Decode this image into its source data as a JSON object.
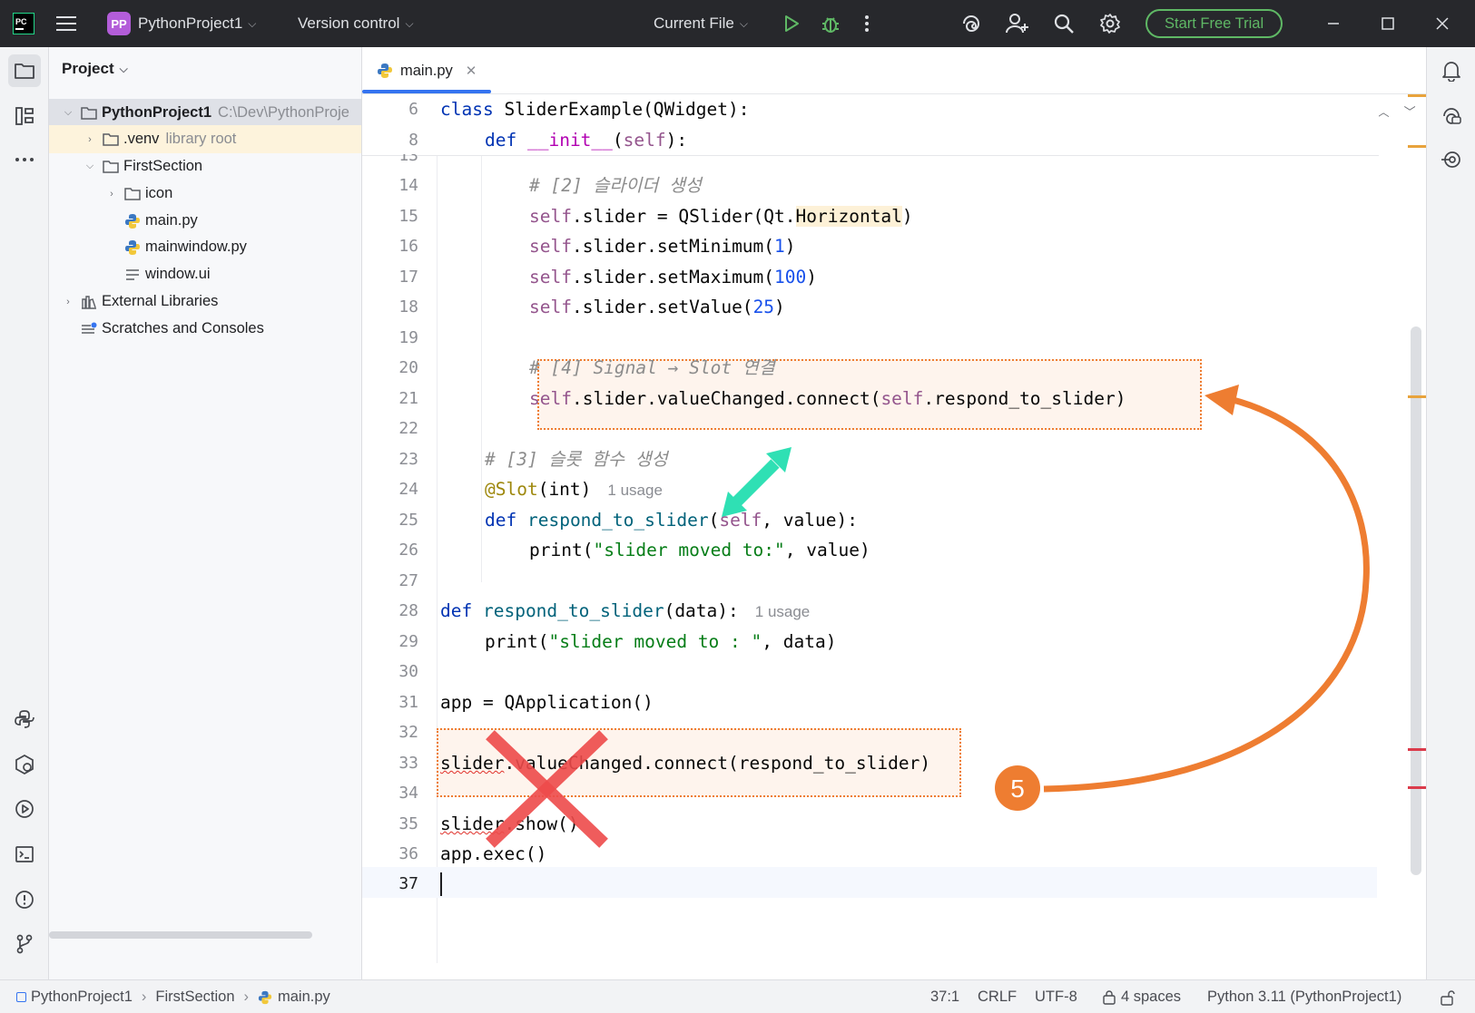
{
  "titlebar": {
    "project_badge": "PP",
    "project_name": "PythonProject1",
    "version_control": "Version control",
    "run_config": "Current File",
    "trial_button": "Start Free Trial"
  },
  "project_panel": {
    "title": "Project",
    "tree": {
      "root_name": "PythonProject1",
      "root_path": "C:\\Dev\\PythonProje",
      "venv": ".venv",
      "venv_hint": "library root",
      "first_section": "FirstSection",
      "icon_folder": "icon",
      "main_py": "main.py",
      "mainwindow_py": "mainwindow.py",
      "window_ui": "window.ui",
      "external_libraries": "External Libraries",
      "scratches": "Scratches and Consoles"
    }
  },
  "editor": {
    "tab_label": "main.py",
    "inspections": {
      "errors": "2",
      "warnings": "3"
    },
    "sticky_line_numbers": [
      "6",
      "8"
    ],
    "partial_line_number": "13",
    "line_numbers": [
      "14",
      "15",
      "16",
      "17",
      "18",
      "19",
      "20",
      "21",
      "22",
      "23",
      "24",
      "25",
      "26",
      "27",
      "28",
      "29",
      "30",
      "31",
      "32",
      "33",
      "34",
      "35",
      "36",
      "37"
    ],
    "code": {
      "s6_kw": "class",
      "s6_rest": " SliderExample(QWidget):",
      "s8_kw": "def",
      "s8_name": "__init__",
      "s8_open": "(",
      "s8_self": "self",
      "s8_close": "):",
      "l14": "# [2] 슬라이더 생성",
      "l15_self": "self",
      "l15_a": ".slider = QSlider(Qt.",
      "l15_hl": "Horizontal",
      "l15_b": ")",
      "l16_self": "self",
      "l16_a": ".slider.setMinimum(",
      "l16_num": "1",
      "l16_b": ")",
      "l17_self": "self",
      "l17_a": ".slider.setMaximum(",
      "l17_num": "100",
      "l17_b": ")",
      "l18_self": "self",
      "l18_a": ".slider.setValue(",
      "l18_num": "25",
      "l18_b": ")",
      "l20": "# [4] Signal → Slot 연결",
      "l21_self1": "self",
      "l21_a": ".slider.valueChanged.connect(",
      "l21_self2": "self",
      "l21_b": ".respond_to_slider)",
      "l23": "# [3] 슬롯 함수 생성",
      "l24_dec": "@Slot",
      "l24_rest": "(int)",
      "l24_inlay": "1 usage",
      "l25_kw": "def",
      "l25_fn": "respond_to_slider",
      "l25_open": "(",
      "l25_self": "self",
      "l25_rest": ", value):",
      "l26_a": "print(",
      "l26_str": "\"slider moved to:\"",
      "l26_b": ", value)",
      "l28_kw": "def",
      "l28_fn": "respond_to_slider",
      "l28_rest": "(data):",
      "l28_inlay": "1 usage",
      "l29_a": "print(",
      "l29_str": "\"slider moved to : \"",
      "l29_b": ", data)",
      "l31": "app = QApplication()",
      "l33_err": "slider",
      "l33_rest": ".valueChanged.connect(respond_to_slider)",
      "l35_err": "slider",
      "l35_rest": ".show()",
      "l36": "app.exec()"
    }
  },
  "annotations": {
    "step_badge": "5",
    "colors": {
      "orange": "#ee7d31",
      "teal": "#2fe0b4",
      "red_x": "#ee4b4b"
    }
  },
  "statusbar": {
    "crumb_project": "PythonProject1",
    "crumb_folder": "FirstSection",
    "crumb_file": "main.py",
    "position": "37:1",
    "line_sep": "CRLF",
    "encoding": "UTF-8",
    "indent": "4 spaces",
    "interpreter": "Python 3.11 (PythonProject1)"
  }
}
